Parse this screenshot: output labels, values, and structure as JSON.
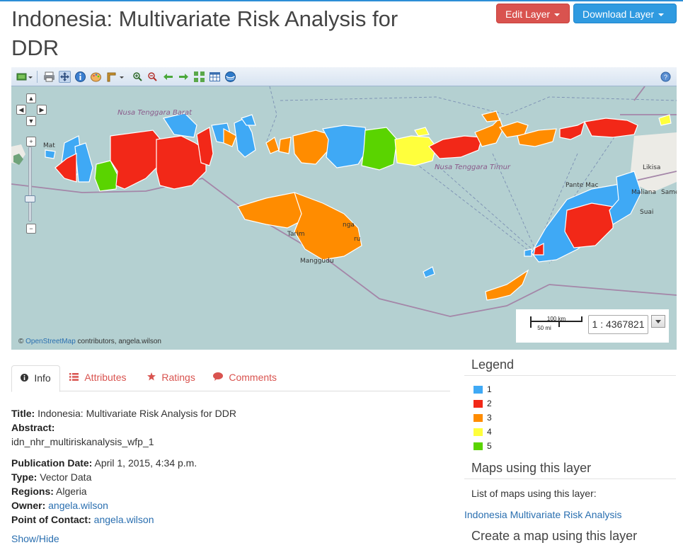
{
  "page": {
    "title": "Indonesia: Multivariate Risk Analysis for DDR"
  },
  "actions": {
    "edit_label": "Edit Layer",
    "download_label": "Download Layer"
  },
  "map": {
    "toolbar_icons": [
      "layers-icon",
      "print-icon",
      "pan-icon",
      "info-icon",
      "style-icon",
      "measure-icon",
      "zoom-in-icon",
      "zoom-out-icon",
      "back-icon",
      "forward-icon",
      "extent-icon",
      "table-icon",
      "globe-icon",
      "help-icon"
    ],
    "place_labels": {
      "nusa_tenggara_barat": "Nusa Tenggara Barat",
      "nusa_tenggara_timur": "Nusa Tenggara Timur",
      "pante_macassar": "Pante Mac",
      "maliana": "Maliana",
      "same": "Same",
      "likisa": "Likisa",
      "suai": "Suai",
      "tarimbang": "Tarim",
      "manggudu": "Manggudu",
      "mat": "Mat",
      "nga": "nga",
      "ru": "ru"
    },
    "scale": {
      "km_label": "100 km",
      "mi_label": "50 mi",
      "ratio": "1 : 4367821"
    },
    "attribution_prefix": "©",
    "attribution_link": "OpenStreetMap",
    "attribution_suffix": "contributors, angela.wilson"
  },
  "tabs": [
    {
      "label": "Info",
      "icon": "info-circle-icon"
    },
    {
      "label": "Attributes",
      "icon": "list-icon"
    },
    {
      "label": "Ratings",
      "icon": "star-icon"
    },
    {
      "label": "Comments",
      "icon": "comment-icon"
    }
  ],
  "info": {
    "title_label": "Title:",
    "title_value": "Indonesia: Multivariate Risk Analysis for DDR",
    "abstract_label": "Abstract:",
    "abstract_value": "idn_nhr_multiriskanalysis_wfp_1",
    "pubdate_label": "Publication Date:",
    "pubdate_value": "April 1, 2015, 4:34 p.m.",
    "type_label": "Type:",
    "type_value": "Vector Data",
    "regions_label": "Regions:",
    "regions_value": "Algeria",
    "owner_label": "Owner:",
    "owner_value": "angela.wilson",
    "poc_label": "Point of Contact:",
    "poc_value": "angela.wilson",
    "show_hide": "Show/Hide"
  },
  "legend": {
    "heading": "Legend",
    "items": [
      {
        "label": "1",
        "color": "#3fa9f5"
      },
      {
        "label": "2",
        "color": "#f22818"
      },
      {
        "label": "3",
        "color": "#ff8c00"
      },
      {
        "label": "4",
        "color": "#ffff3c"
      },
      {
        "label": "5",
        "color": "#5ad400"
      }
    ]
  },
  "maps_using": {
    "heading": "Maps using this layer",
    "description": "List of maps using this layer:",
    "link": "Indonesia Multivariate Risk Analysis"
  },
  "create_map": {
    "heading": "Create a map using this layer"
  },
  "colors": {
    "sea": "#b4d0d1",
    "land": "#ecebe6",
    "border": "#a486a8"
  }
}
